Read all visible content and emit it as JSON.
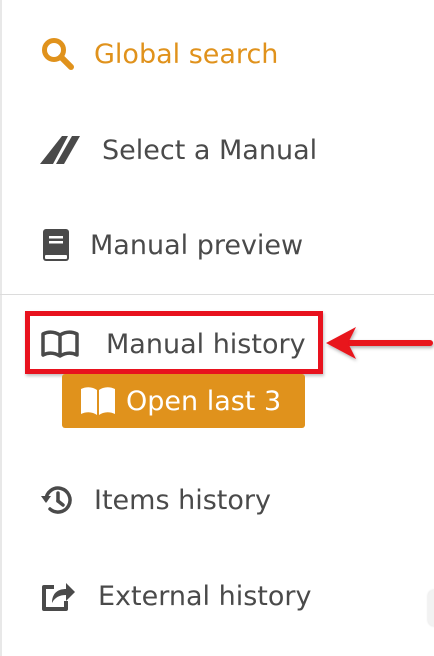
{
  "menu": {
    "global_search": {
      "label": "Global search",
      "icon": "search-icon"
    },
    "select_manual": {
      "label": "Select a Manual",
      "icon": "manual-select-icon"
    },
    "manual_preview": {
      "label": "Manual preview",
      "icon": "book-icon"
    },
    "manual_history": {
      "label": "Manual history",
      "icon": "open-book-icon"
    },
    "open_last": {
      "label": "Open last 3",
      "icon": "open-book-icon"
    },
    "items_history": {
      "label": "Items history",
      "icon": "history-icon"
    },
    "external_history": {
      "label": "External history",
      "icon": "external-share-icon"
    }
  },
  "colors": {
    "accent": "#e0921c",
    "text": "#4a4a4a",
    "highlight": "#e8121e"
  }
}
